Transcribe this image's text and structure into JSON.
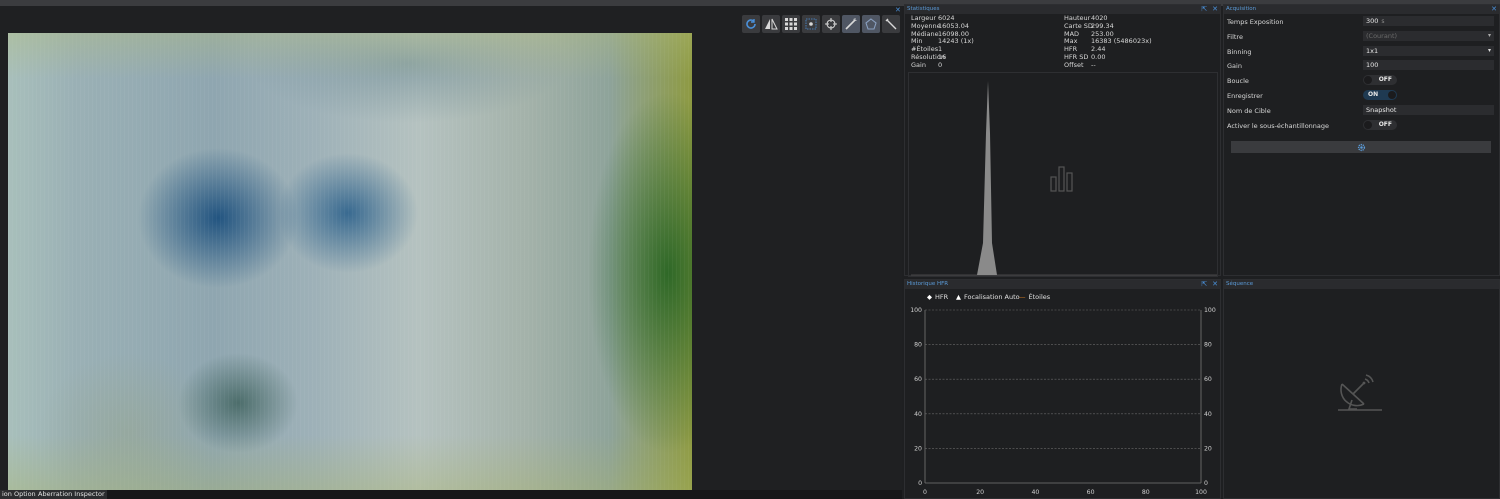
{
  "image_panel": {
    "close_icon": "close-icon"
  },
  "toolbar": {
    "buttons": [
      {
        "name": "refresh-icon",
        "active": false
      },
      {
        "name": "flip-icon",
        "active": false
      },
      {
        "name": "grid-icon",
        "active": false
      },
      {
        "name": "star-crosshair-icon",
        "active": false
      },
      {
        "name": "crosshair-icon",
        "active": false
      },
      {
        "name": "wand-icon",
        "active": true
      },
      {
        "name": "shape-icon",
        "active": true
      },
      {
        "name": "telescope-icon",
        "active": false
      }
    ]
  },
  "bottom_tabs": [
    "ion Options",
    "Aberration Inspector"
  ],
  "stats": {
    "title": "Statistiques",
    "rows": [
      {
        "l1": "Largeur",
        "v1": "6024",
        "l2": "Hauteur",
        "v2": "4020"
      },
      {
        "l1": "Moyenne",
        "v1": "16053.04",
        "l2": "Carte SD",
        "v2": "299.34"
      },
      {
        "l1": "Médiane",
        "v1": "16098.00",
        "l2": "MAD",
        "v2": "253.00"
      },
      {
        "l1": "Min",
        "v1": "14243 (1x)",
        "l2": "Max",
        "v2": "16383 (5486023x)"
      },
      {
        "l1": "#Étoiles",
        "v1": "1",
        "l2": "HFR",
        "v2": "2.44"
      },
      {
        "l1": "Résolution",
        "v1": "16",
        "l2": "HFR SD",
        "v2": "0.00"
      },
      {
        "l1": "Gain",
        "v1": "0",
        "l2": "Offset",
        "v2": "--"
      }
    ]
  },
  "hfr": {
    "title": "Historique HFR",
    "legend": [
      {
        "label": "HFR",
        "color": "#ffffff"
      },
      {
        "label": "Focalisation Auto",
        "color": "#ffffff"
      },
      {
        "label": "Étoiles",
        "color": "#e08020"
      }
    ]
  },
  "chart_data": {
    "type": "line",
    "title": "",
    "xlabel": "",
    "ylabel": "",
    "xlim": [
      0,
      100
    ],
    "ylim": [
      0,
      100
    ],
    "x_ticks": [
      "0",
      "20",
      "40",
      "60",
      "80",
      "100"
    ],
    "y_ticks": [
      "0",
      "20",
      "40",
      "60",
      "80",
      "100"
    ],
    "grid": true,
    "legend_position": "top-left",
    "series": [
      {
        "name": "HFR",
        "values": []
      },
      {
        "name": "Focalisation Auto",
        "values": []
      },
      {
        "name": "Étoiles",
        "values": []
      }
    ]
  },
  "acquisition": {
    "title": "Acquisition",
    "exposure": {
      "label": "Temps Exposition",
      "value": "300",
      "unit": "s"
    },
    "filter": {
      "label": "Filtre",
      "value": "(Courant)"
    },
    "binning": {
      "label": "Binning",
      "value": "1x1"
    },
    "gain": {
      "label": "Gain",
      "value": "100"
    },
    "loop": {
      "label": "Boucle",
      "state": "OFF"
    },
    "save": {
      "label": "Enregistrer",
      "state": "ON"
    },
    "target": {
      "label": "Nom de Cible",
      "value": "Snapshot"
    },
    "subsample": {
      "label": "Activer le sous-échantillonnage",
      "state": "OFF"
    }
  },
  "sequence": {
    "title": "Séquence"
  },
  "colors": {
    "accent": "#4a90d9",
    "panel_bg": "#1e1f21"
  }
}
